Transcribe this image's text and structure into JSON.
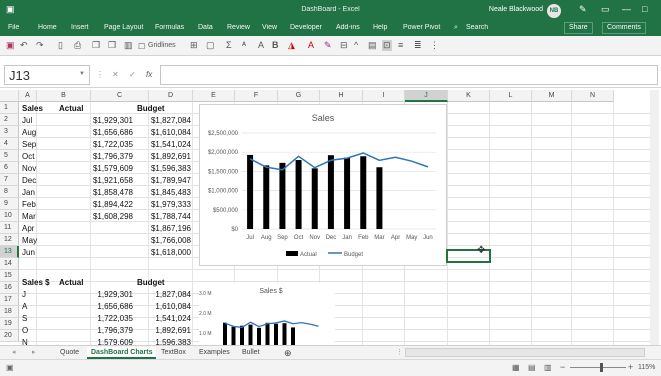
{
  "titlebar": {
    "document": "DashBoard - Excel",
    "user": "Neale Blackwood",
    "initials": "NB"
  },
  "ribbon_tabs": [
    "File",
    "Home",
    "Insert",
    "Page Layout",
    "Formulas",
    "Data",
    "Review",
    "View",
    "Developer",
    "Add-ins",
    "Help",
    "Power Pivot"
  ],
  "search_label": "Search",
  "share_label": "Share",
  "comments_label": "Comments",
  "gridlines_label": "Gridlines",
  "namebox": "J13",
  "fx_label": "fx",
  "columns": [
    "A",
    "B",
    "C",
    "D",
    "E",
    "F",
    "G",
    "H",
    "I",
    "J",
    "K",
    "L",
    "M",
    "N"
  ],
  "rows": [
    "1",
    "2",
    "3",
    "4",
    "5",
    "6",
    "7",
    "8",
    "9",
    "10",
    "11",
    "12",
    "13",
    "14",
    "15",
    "16",
    "17",
    "18",
    "19",
    "20"
  ],
  "table1": {
    "headers": [
      "Sales",
      "Actual",
      "Budget"
    ],
    "rows": [
      {
        "m": "Jul",
        "a": "$1,929,301",
        "b": "$1,827,084"
      },
      {
        "m": "Aug",
        "a": "$1,656,686",
        "b": "$1,610,084"
      },
      {
        "m": "Sep",
        "a": "$1,722,035",
        "b": "$1,541,024"
      },
      {
        "m": "Oct",
        "a": "$1,796,379",
        "b": "$1,892,691"
      },
      {
        "m": "Nov",
        "a": "$1,579,609",
        "b": "$1,596,383"
      },
      {
        "m": "Dec",
        "a": "$1,921,658",
        "b": "$1,789,947"
      },
      {
        "m": "Jan",
        "a": "$1,858,478",
        "b": "$1,845,483"
      },
      {
        "m": "Feb",
        "a": "$1,894,422",
        "b": "$1,979,333"
      },
      {
        "m": "Mar",
        "a": "$1,608,298",
        "b": "$1,788,744"
      },
      {
        "m": "Apr",
        "a": "",
        "b": "$1,867,196"
      },
      {
        "m": "May",
        "a": "",
        "b": "$1,766,008"
      },
      {
        "m": "Jun",
        "a": "",
        "b": "$1,618,000"
      }
    ]
  },
  "table2": {
    "headers": [
      "Sales $",
      "Actual",
      "Budget"
    ],
    "rows": [
      {
        "m": "J",
        "a": "1,929,301",
        "b": "1,827,084"
      },
      {
        "m": "A",
        "a": "1,656,686",
        "b": "1,610,084"
      },
      {
        "m": "S",
        "a": "1,722,035",
        "b": "1,541,024"
      },
      {
        "m": "O",
        "a": "1,796,379",
        "b": "1,892,691"
      },
      {
        "m": "N",
        "a": "1,579,609",
        "b": "1,596,383"
      }
    ]
  },
  "chart_data": [
    {
      "type": "bar",
      "title": "Sales",
      "categories": [
        "Jul",
        "Aug",
        "Sep",
        "Oct",
        "Nov",
        "Dec",
        "Jan",
        "Feb",
        "Mar",
        "Apr",
        "May",
        "Jun"
      ],
      "series": [
        {
          "name": "Actual",
          "type": "bar",
          "color": "#000000",
          "values": [
            1929301,
            1656686,
            1722035,
            1796379,
            1579609,
            1921658,
            1858478,
            1894422,
            1608298,
            null,
            null,
            null
          ]
        },
        {
          "name": "Budget",
          "type": "line",
          "color": "#2e75b6",
          "values": [
            1827084,
            1610084,
            1541024,
            1892691,
            1596383,
            1789947,
            1845483,
            1979333,
            1788744,
            1867196,
            1766008,
            1618000
          ]
        }
      ],
      "yticks": [
        "$2,500,000",
        "$2,000,000",
        "$1,500,000",
        "$1,000,000",
        "$500,000",
        "$0"
      ],
      "ylim": [
        0,
        2500000
      ],
      "legend": "bottom"
    },
    {
      "type": "bar",
      "title": "Sales $",
      "yticks": [
        "3.0 M",
        "2.0 M",
        "1.0 M"
      ]
    }
  ],
  "sheet_tabs": [
    "Quote",
    "DashBoard Charts",
    "TextBox",
    "Examples",
    "Bullet"
  ],
  "active_tab": "DashBoard Charts",
  "zoom": "115%",
  "colors": {
    "excel_green": "#217346",
    "bar": "#000000",
    "line": "#2e75b6"
  }
}
